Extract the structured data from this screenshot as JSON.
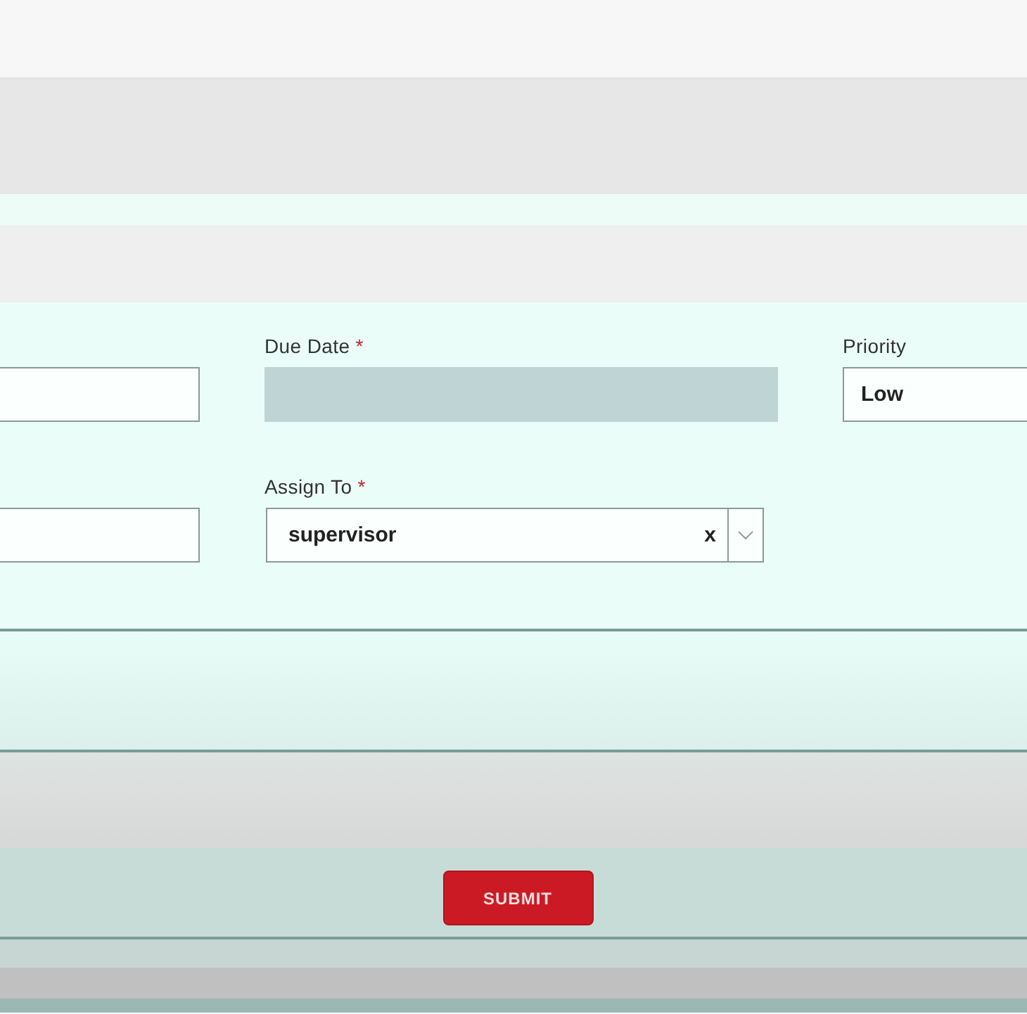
{
  "required_marker": "*",
  "fields": [
    {
      "kind": "text",
      "required": false,
      "disabled": false
    },
    {
      "kind": "date",
      "label": "Due Date",
      "required": true,
      "disabled": true
    },
    {
      "kind": "text",
      "label": "Priority",
      "required": false,
      "disabled": false,
      "value": "Low"
    },
    {
      "kind": "text",
      "required": false,
      "disabled": false
    },
    {
      "kind": "select",
      "label": "Assign To",
      "required": true,
      "disabled": false,
      "value": "supervisor",
      "clear_label": "x"
    }
  ],
  "submit_button": {
    "label": "SUBMIT"
  }
}
